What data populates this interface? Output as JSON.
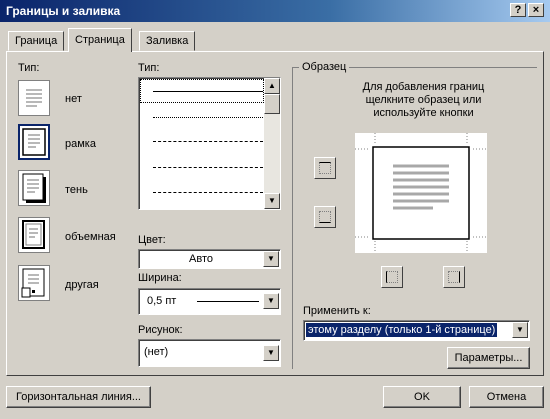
{
  "window": {
    "title": "Границы и заливка",
    "help_btn": "?",
    "close_btn": "×"
  },
  "tabs": [
    "Граница",
    "Страница",
    "Заливка"
  ],
  "type_section": {
    "label": "Тип:",
    "items": [
      "нет",
      "рамка",
      "тень",
      "объемная",
      "другая"
    ],
    "selected": "рамка"
  },
  "line_style": {
    "label": "Тип:"
  },
  "color": {
    "label": "Цвет:",
    "value": "Авто"
  },
  "width": {
    "label": "Ширина:",
    "value": "0,5 пт"
  },
  "art": {
    "label": "Рисунок:",
    "value": "(нет)"
  },
  "preview": {
    "label": "Образец",
    "hint": "Для добавления границ щелкните образец или используйте кнопки"
  },
  "apply_to": {
    "label": "Применить к:",
    "value": "этому разделу (только 1-й странице)"
  },
  "buttons": {
    "options": "Параметры...",
    "horizontal_line": "Горизонтальная линия...",
    "ok": "OK",
    "cancel": "Отмена"
  }
}
